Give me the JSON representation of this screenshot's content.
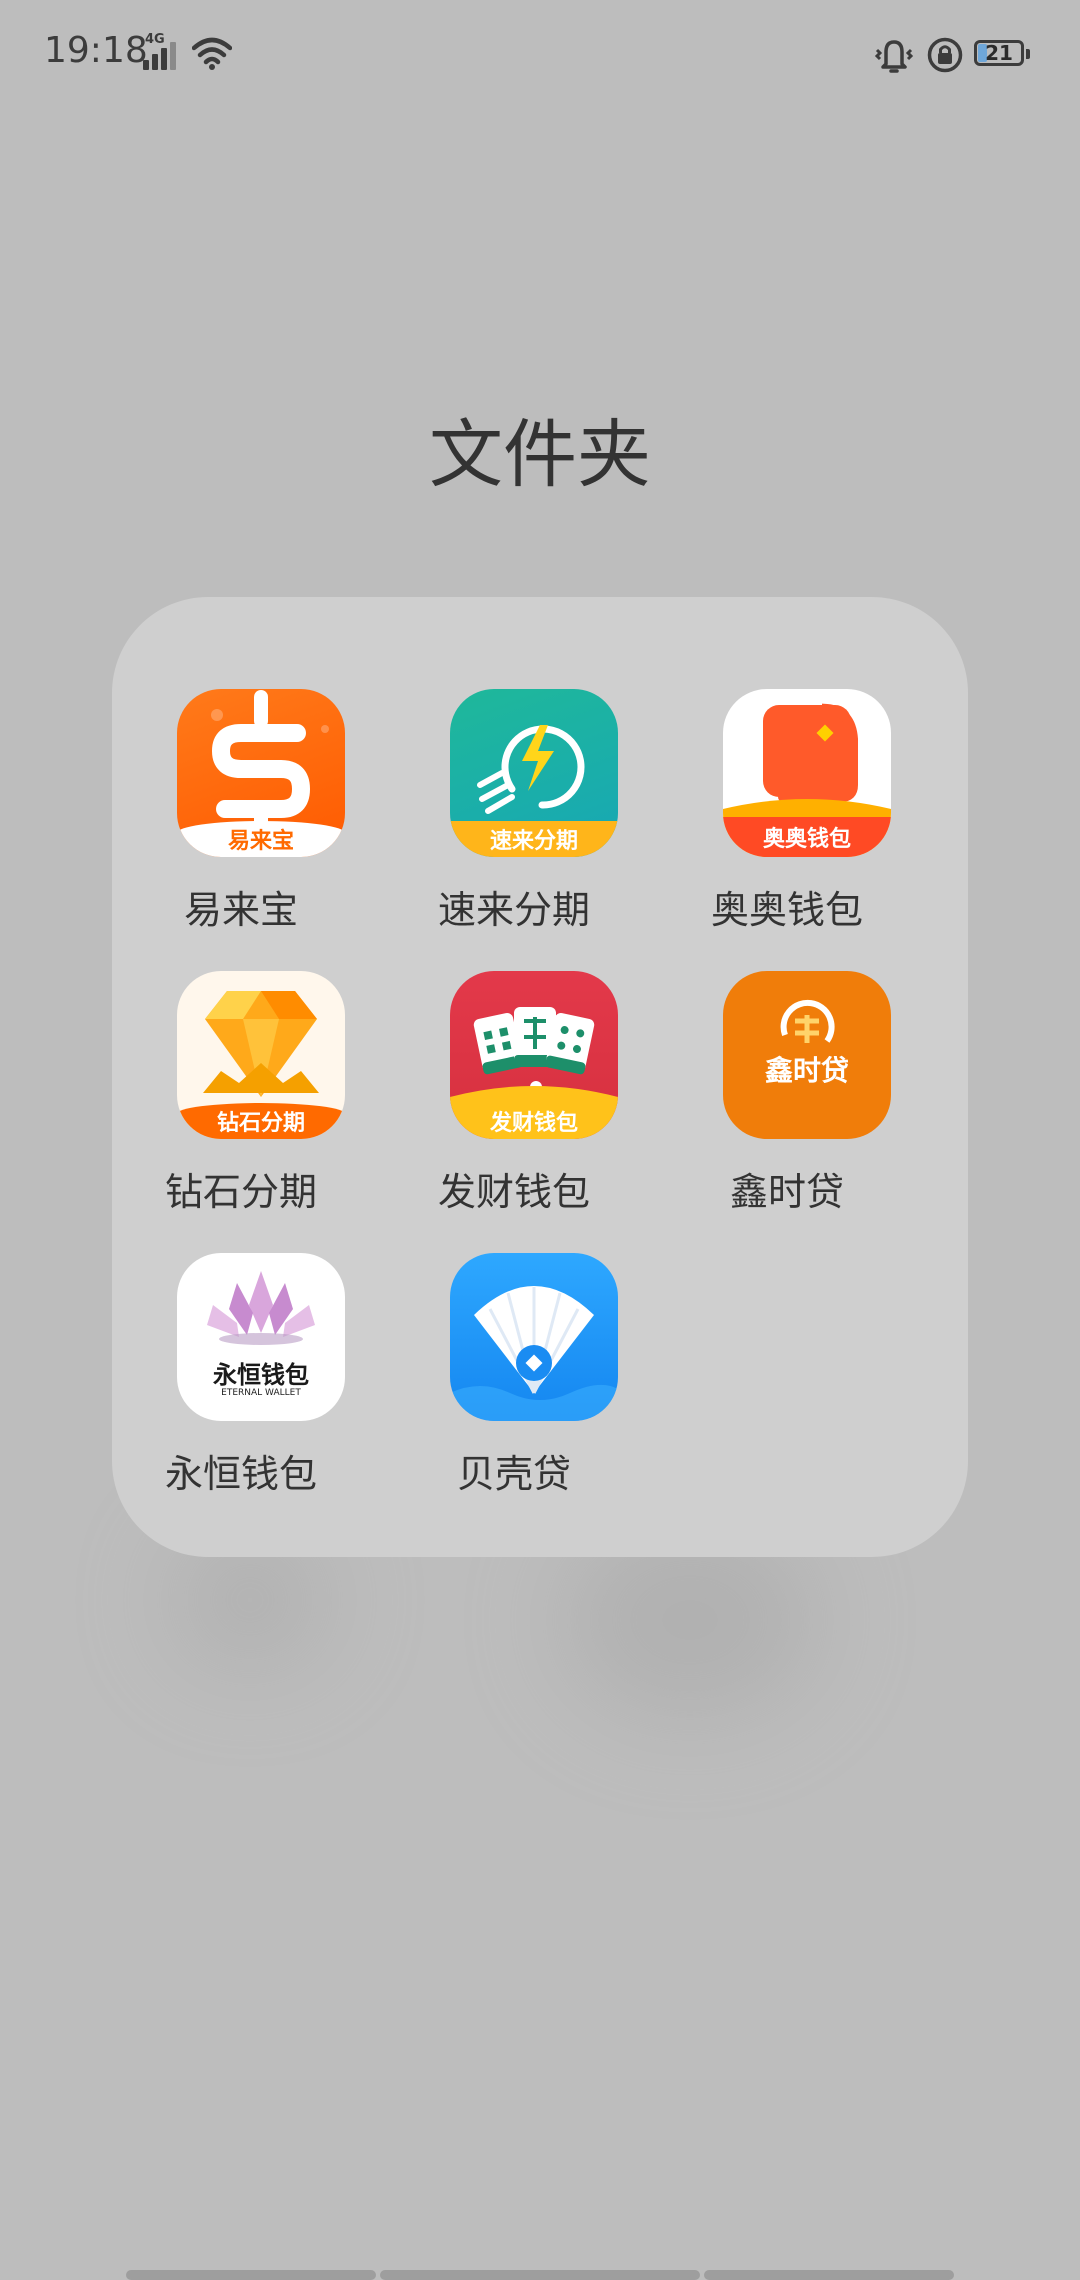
{
  "status_bar": {
    "time": "19:18",
    "network_label": "4G",
    "battery_level": "21",
    "icons": [
      "signal-icon",
      "wifi-icon",
      "vibrate-icon",
      "rotation-lock-icon",
      "battery-icon"
    ]
  },
  "folder": {
    "title": "文件夹",
    "apps": [
      {
        "name": "易来宝",
        "band_text": "易来宝",
        "icon": "yilaibao-app-icon"
      },
      {
        "name": "速来分期",
        "band_text": "速来分期",
        "icon": "sulai-fenqi-app-icon"
      },
      {
        "name": "奥奥钱包",
        "band_text": "奥奥钱包",
        "icon": "aoao-wallet-app-icon"
      },
      {
        "name": "钻石分期",
        "band_text": "钻石分期",
        "icon": "diamond-fenqi-app-icon"
      },
      {
        "name": "发财钱包",
        "band_text": "发财钱包",
        "icon": "facai-wallet-app-icon"
      },
      {
        "name": "鑫时贷",
        "band_text": "鑫时贷",
        "icon": "xinshidai-app-icon"
      },
      {
        "name": "永恒钱包",
        "band_text": "永恒钱包",
        "sub_text": "ETERNAL WALLET",
        "icon": "eternal-wallet-app-icon"
      },
      {
        "name": "贝壳贷",
        "band_text": "",
        "icon": "beike-loan-app-icon"
      }
    ]
  },
  "colors": {
    "background": "#bdbdbd",
    "panel": "#cfcfcf",
    "text": "#333333"
  }
}
